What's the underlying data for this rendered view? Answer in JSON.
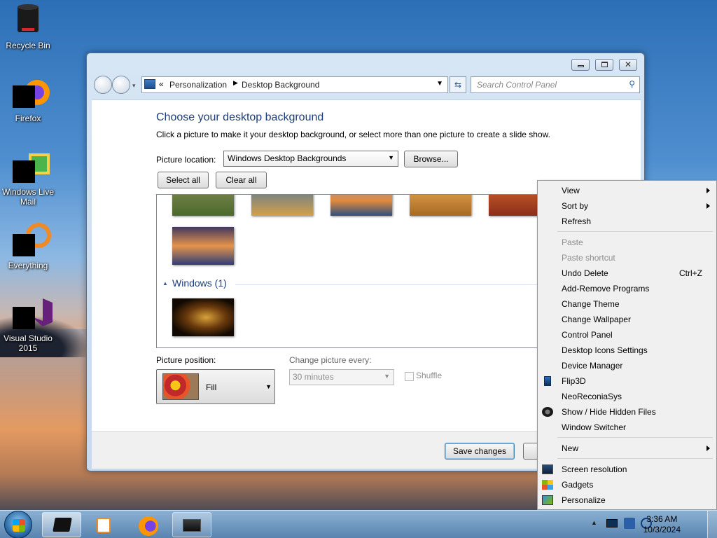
{
  "desktop": {
    "icons": [
      {
        "label": "Recycle Bin"
      },
      {
        "label": "Firefox"
      },
      {
        "label": "Windows Live Mail"
      },
      {
        "label": "Everything"
      },
      {
        "label": "Visual Studio 2015"
      }
    ]
  },
  "window": {
    "breadcrumb": {
      "prefix": "«",
      "parent": "Personalization",
      "current": "Desktop Background"
    },
    "search_placeholder": "Search Control Panel",
    "heading": "Choose your desktop background",
    "subtitle": "Click a picture to make it your desktop background, or select more than one picture to create a slide show.",
    "picture_location_label": "Picture location:",
    "picture_location_value": "Windows Desktop Backgrounds",
    "browse_label": "Browse...",
    "select_all_label": "Select all",
    "clear_all_label": "Clear all",
    "group_label": "Windows (1)",
    "picture_position_label": "Picture position:",
    "picture_position_value": "Fill",
    "change_every_label": "Change picture every:",
    "change_every_value": "30 minutes",
    "shuffle_label": "Shuffle",
    "save_label": "Save changes"
  },
  "context_menu": {
    "items": [
      {
        "label": "View",
        "submenu": true
      },
      {
        "label": "Sort by",
        "submenu": true
      },
      {
        "label": "Refresh"
      },
      {
        "label": "Paste",
        "disabled": true
      },
      {
        "label": "Paste shortcut",
        "disabled": true
      },
      {
        "label": "Undo Delete",
        "shortcut": "Ctrl+Z"
      },
      {
        "label": "Add-Remove Programs"
      },
      {
        "label": "Change Theme"
      },
      {
        "label": "Change Wallpaper"
      },
      {
        "label": "Control Panel"
      },
      {
        "label": "Desktop Icons Settings"
      },
      {
        "label": "Device Manager"
      },
      {
        "label": "Flip3D",
        "icon": "flip3d-icon"
      },
      {
        "label": "NeoReconiaSys"
      },
      {
        "label": "Show / Hide Hidden Files",
        "icon": "hidden-files-icon"
      },
      {
        "label": "Window Switcher"
      },
      {
        "label": "New",
        "submenu": true
      },
      {
        "label": "Screen resolution",
        "icon": "monitor-icon"
      },
      {
        "label": "Gadgets",
        "icon": "gadgets-icon"
      },
      {
        "label": "Personalize",
        "icon": "personalize-icon"
      }
    ]
  },
  "taskbar": {
    "time": "3:36 AM",
    "date": "10/3/2024"
  }
}
